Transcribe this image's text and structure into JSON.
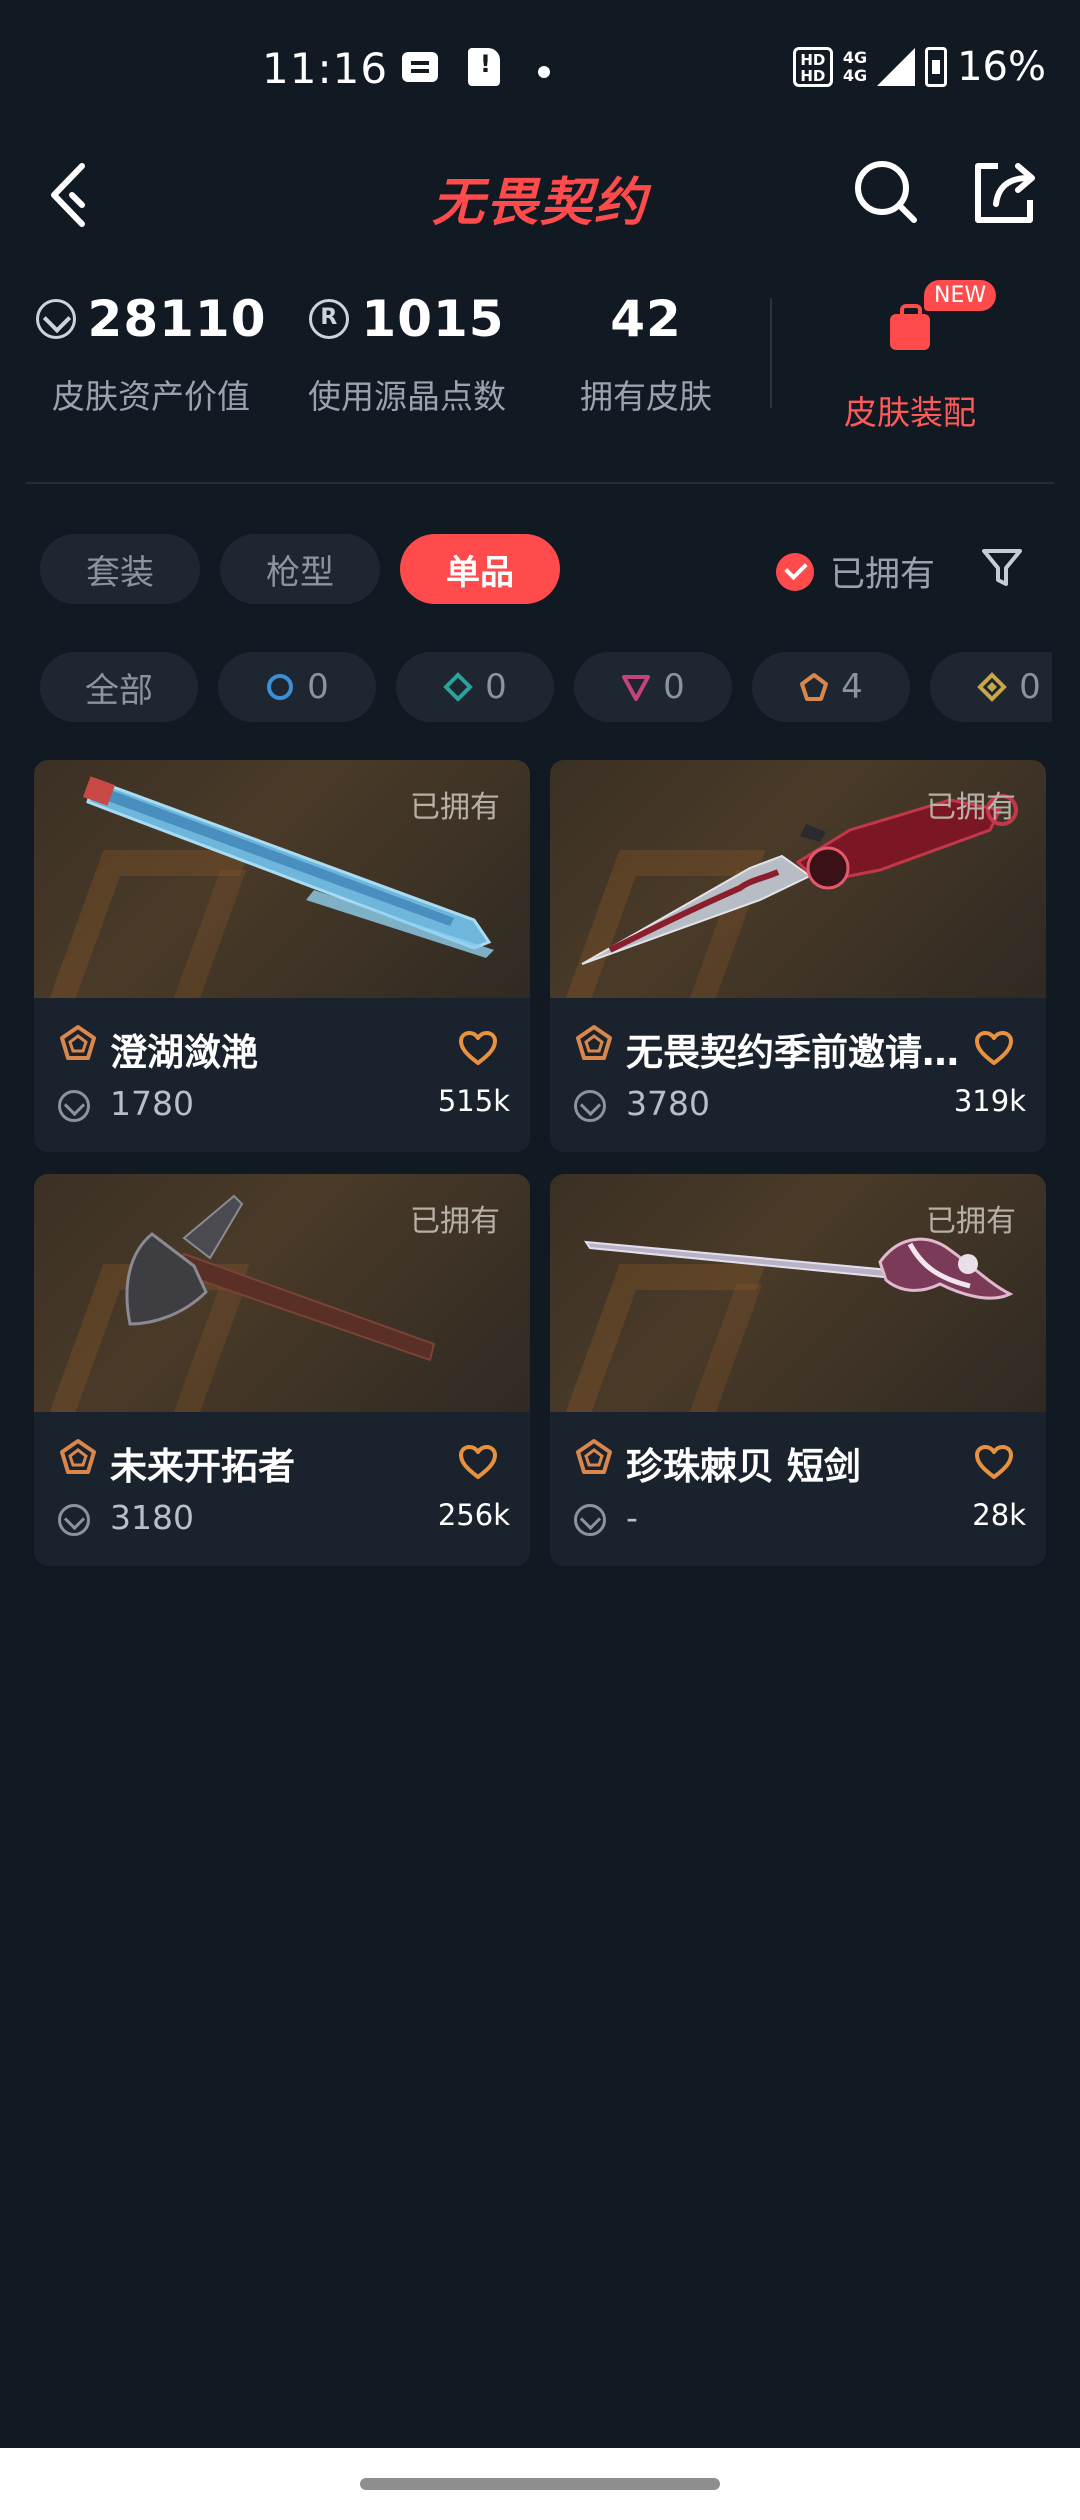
{
  "status_bar": {
    "time": "11:16",
    "network": "4G",
    "battery": "16%"
  },
  "nav": {
    "title": "无畏契约",
    "icons": [
      "back-icon",
      "search-icon",
      "share-icon"
    ]
  },
  "stats": {
    "asset_value": "28110",
    "asset_value_label": "皮肤资产价值",
    "points_used": "1015",
    "points_used_label": "使用源晶点数",
    "owned_count": "42",
    "owned_count_label": "拥有皮肤",
    "equip_label": "皮肤装配",
    "new_badge": "NEW"
  },
  "tabs": [
    {
      "label": "套装",
      "active": false
    },
    {
      "label": "枪型",
      "active": false
    },
    {
      "label": "单品",
      "active": true
    }
  ],
  "owned_filter": {
    "label": "已拥有",
    "checked": true
  },
  "rarity_chips": [
    {
      "label": "全部"
    },
    {
      "count": "0",
      "color": "#3b8fd6",
      "icon": "select-tier-icon"
    },
    {
      "count": "0",
      "color": "#2aa39b",
      "icon": "deluxe-tier-icon"
    },
    {
      "count": "0",
      "color": "#c2437e",
      "icon": "premium-tier-icon"
    },
    {
      "count": "4",
      "color": "#d9874c",
      "icon": "exclusive-tier-icon"
    },
    {
      "count": "0",
      "color": "#c9a84a",
      "icon": "ultra-tier-icon"
    }
  ],
  "cards": [
    {
      "name": "澄湖潋滟",
      "price": "1780",
      "likes": "515k",
      "owned": "已拥有",
      "weapon": "fan-blade"
    },
    {
      "name": "无畏契约季前邀请赛 蝴蝶刀",
      "price": "3780",
      "likes": "319k",
      "owned": "已拥有",
      "weapon": "red-dagger"
    },
    {
      "name": "未来开拓者",
      "price": "3180",
      "likes": "256k",
      "owned": "已拥有",
      "weapon": "axe"
    },
    {
      "name": "珍珠棘贝 短剑",
      "price": "-",
      "likes": "28k",
      "owned": "已拥有",
      "weapon": "pearl-rapier"
    }
  ]
}
